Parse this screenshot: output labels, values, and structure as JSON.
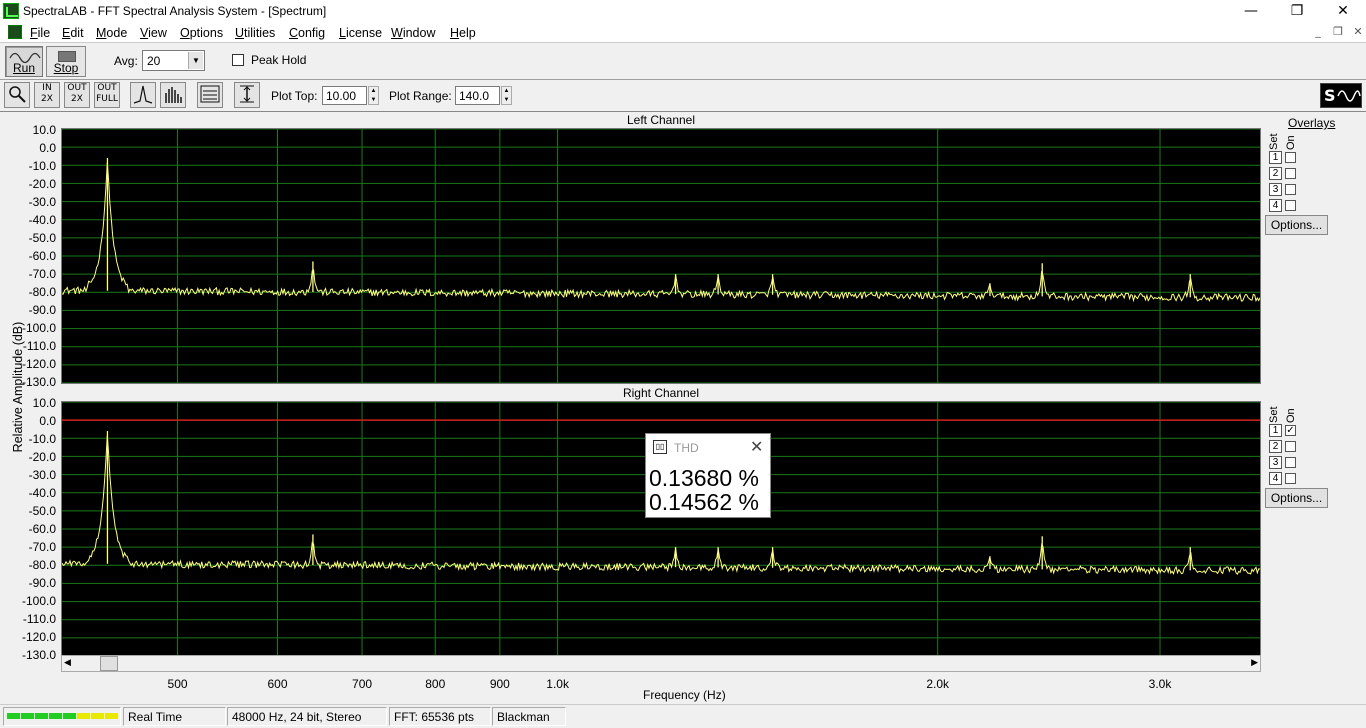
{
  "window": {
    "title": "SpectraLAB - FFT Spectral Analysis System - [Spectrum]",
    "minimize": "—",
    "restore": "❐",
    "close": "✕"
  },
  "menu": [
    {
      "first": "F",
      "rest": "ile"
    },
    {
      "first": "E",
      "rest": "dit"
    },
    {
      "first": "M",
      "rest": "ode"
    },
    {
      "first": "V",
      "rest": "iew"
    },
    {
      "first": "O",
      "rest": "ptions"
    },
    {
      "first": "U",
      "rest": "tilities"
    },
    {
      "first": "C",
      "rest": "onfig"
    },
    {
      "first": "L",
      "rest": "icense"
    },
    {
      "first": "W",
      "rest": "indow"
    },
    {
      "first": "H",
      "rest": "elp"
    }
  ],
  "toolbar": {
    "run_label": "Run",
    "stop_label": "Stop",
    "avg_label": "Avg:",
    "avg_value": "20",
    "peak_hold_label": "Peak Hold",
    "plot_top_label": "Plot Top:",
    "plot_top_value": "10.00",
    "plot_range_label": "Plot Range:",
    "plot_range_value": "140.0",
    "zoom_in_2x": "IN 2X",
    "zoom_out_2x": "OUT 2X",
    "zoom_out_full": "OUT FULL"
  },
  "y_axis": {
    "label": "Relative Amplitude (dB)",
    "ticks": [
      "10.0",
      "0.0",
      "-10.0",
      "-20.0",
      "-30.0",
      "-40.0",
      "-50.0",
      "-60.0",
      "-70.0",
      "-80.0",
      "-90.0",
      "-100.0",
      "-110.0",
      "-120.0",
      "-130.0"
    ]
  },
  "x_axis": {
    "label": "Frequency (Hz)",
    "ticks": [
      {
        "label": "500",
        "hz": 500
      },
      {
        "label": "600",
        "hz": 600
      },
      {
        "label": "700",
        "hz": 700
      },
      {
        "label": "800",
        "hz": 800
      },
      {
        "label": "900",
        "hz": 900
      },
      {
        "label": "1.0k",
        "hz": 1000
      },
      {
        "label": "2.0k",
        "hz": 2000
      },
      {
        "label": "3.0k",
        "hz": 3000
      }
    ]
  },
  "overlays": {
    "title": "Overlays",
    "set_label": "Set",
    "on_label": "On",
    "options_label": "Options...",
    "sets": [
      "1",
      "2",
      "3",
      "4"
    ],
    "left_checked": [
      false,
      false,
      false,
      false
    ],
    "right_checked": [
      true,
      false,
      false,
      false
    ],
    "check_mark": "✓"
  },
  "channels": [
    {
      "title": "Left Channel",
      "trace_color": "#ffff80"
    },
    {
      "title": "Right Channel",
      "trace_color": "#ffff80",
      "reference_line_db": 0.0,
      "reference_color": "#d02020"
    }
  ],
  "chart_data": [
    {
      "type": "line",
      "title": "Left Channel",
      "xlabel": "Frequency (Hz)",
      "ylabel": "Relative Amplitude (dB)",
      "ylim": [
        -130,
        10
      ],
      "xscale": "log",
      "grid": true,
      "noise_floor_db": [
        -79,
        -83
      ],
      "peaks": [
        {
          "x": 440,
          "y": -6
        },
        {
          "x": 640,
          "y": -63
        },
        {
          "x": 1240,
          "y": -70
        },
        {
          "x": 1340,
          "y": -70
        },
        {
          "x": 1480,
          "y": -70
        },
        {
          "x": 2200,
          "y": -75
        },
        {
          "x": 2420,
          "y": -64
        },
        {
          "x": 3170,
          "y": -70
        }
      ]
    },
    {
      "type": "line",
      "title": "Right Channel",
      "xlabel": "Frequency (Hz)",
      "ylabel": "Relative Amplitude (dB)",
      "ylim": [
        -130,
        10
      ],
      "xscale": "log",
      "grid": true,
      "noise_floor_db": [
        -79,
        -83
      ],
      "peaks": [
        {
          "x": 440,
          "y": -6
        },
        {
          "x": 640,
          "y": -63
        },
        {
          "x": 1240,
          "y": -70
        },
        {
          "x": 1340,
          "y": -70
        },
        {
          "x": 1480,
          "y": -70
        },
        {
          "x": 2200,
          "y": -75
        },
        {
          "x": 2420,
          "y": -64
        },
        {
          "x": 3170,
          "y": -70
        }
      ]
    }
  ],
  "thd": {
    "title": "THD",
    "left": "0.13680 %",
    "right": "0.14562 %"
  },
  "status": {
    "mode": "Real Time",
    "format": "48000 Hz, 24 bit, Stereo",
    "fft": "FFT: 65536 pts",
    "window": "Blackman",
    "led_colors": [
      "#22cc22",
      "#22cc22",
      "#22cc22",
      "#22cc22",
      "#22cc22",
      "#e8e800",
      "#e8e800",
      "#e8e800"
    ]
  }
}
